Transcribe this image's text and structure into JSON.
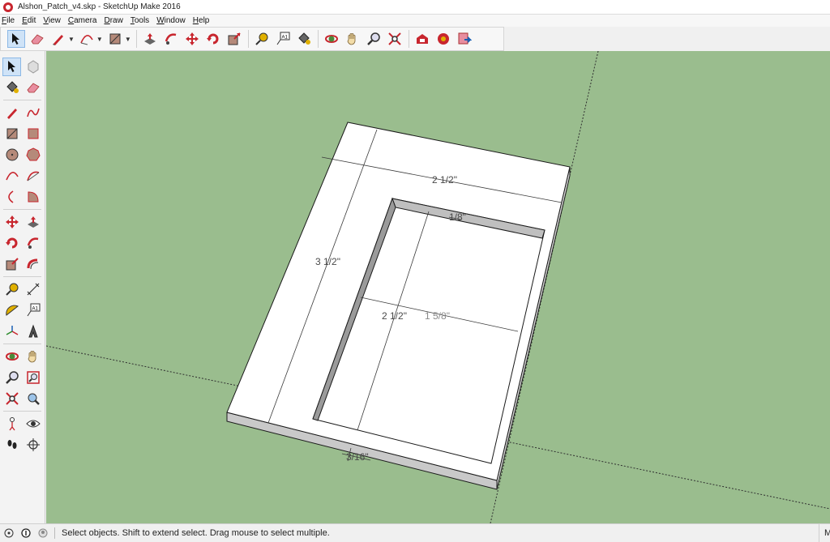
{
  "window": {
    "title": "Alshon_Patch_v4.skp - SketchUp Make 2016"
  },
  "menu": [
    {
      "label": "File",
      "name": "menu-file"
    },
    {
      "label": "Edit",
      "name": "menu-edit"
    },
    {
      "label": "View",
      "name": "menu-view"
    },
    {
      "label": "Camera",
      "name": "menu-camera"
    },
    {
      "label": "Draw",
      "name": "menu-draw"
    },
    {
      "label": "Tools",
      "name": "menu-tools"
    },
    {
      "label": "Window",
      "name": "menu-window"
    },
    {
      "label": "Help",
      "name": "menu-help"
    }
  ],
  "toolbar": {
    "tools": [
      "select-icon",
      "eraser-icon",
      "pencil-icon",
      "arc-icon",
      "rectangle-icon",
      "push-pull-icon",
      "follow-me-icon",
      "move-icon",
      "rotate-icon",
      "scale-icon",
      "tape-measure-icon",
      "text-icon",
      "paint-bucket-icon",
      "orbit-icon",
      "pan-icon",
      "zoom-icon",
      "zoom-extents-icon",
      "warehouse-icon",
      "extension-warehouse-icon",
      "send-to-layout-icon"
    ]
  },
  "dimensions": {
    "outer_width": "2 1/2\"",
    "outer_length": "3 1/2\"",
    "inner_width": "2 1/2\"",
    "inner_length": "1 5/8\"",
    "recess_depth": "1/8\"",
    "thickness": "3/16\""
  },
  "status": {
    "text": "Select objects. Shift to extend select. Drag mouse to select multiple.",
    "measurements_label": "Me"
  },
  "colors": {
    "ground": "#9abd8e",
    "model_face": "#ffffff",
    "model_side": "#c9c9c9",
    "edge": "#1a1a1a",
    "accent_red": "#c8262e"
  }
}
